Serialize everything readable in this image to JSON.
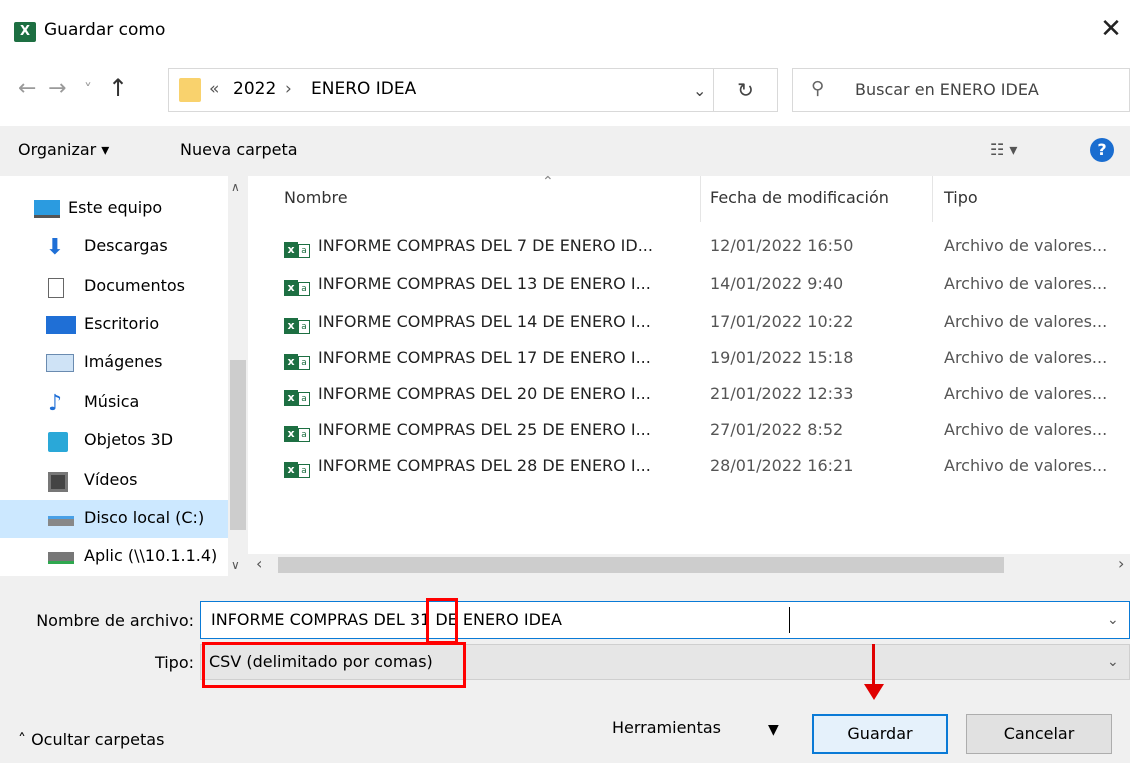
{
  "window": {
    "title": "Guardar como",
    "app_icon": "X",
    "close_glyph": "✕"
  },
  "nav": {
    "back_glyph": "←",
    "forward_glyph": "→",
    "recent_glyph": "˅",
    "up_glyph": "↑",
    "breadcrumb": {
      "overflow": "«",
      "items": [
        "2022",
        "ENERO IDEA"
      ],
      "separator": "›"
    },
    "refresh_glyph": "↻",
    "search_placeholder": "Buscar en ENERO IDEA"
  },
  "toolbar": {
    "organize_label": "Organizar ▾",
    "new_folder_label": "Nueva carpeta",
    "view_glyph": "☷ ▾",
    "help_glyph": "?"
  },
  "sidebar": {
    "items": [
      {
        "label": "Este equipo",
        "icon": "monitor-icon"
      },
      {
        "label": "Descargas",
        "icon": "download-icon"
      },
      {
        "label": "Documentos",
        "icon": "document-icon"
      },
      {
        "label": "Escritorio",
        "icon": "desktop-icon"
      },
      {
        "label": "Imágenes",
        "icon": "image-icon"
      },
      {
        "label": "Música",
        "icon": "music-icon"
      },
      {
        "label": "Objetos 3D",
        "icon": "cube-icon"
      },
      {
        "label": "Vídeos",
        "icon": "film-icon"
      },
      {
        "label": "Disco local (C:)",
        "icon": "drive-icon",
        "selected": true
      },
      {
        "label": "Aplic (\\\\10.1.1.4)",
        "icon": "network-drive-icon"
      }
    ]
  },
  "file_list": {
    "columns": [
      "Nombre",
      "Fecha de modificación",
      "Tipo"
    ],
    "rows": [
      {
        "name": "INFORME COMPRAS DEL 7 DE ENERO ID...",
        "date": "12/01/2022 16:50",
        "type": "Archivo de valores..."
      },
      {
        "name": "INFORME COMPRAS DEL 13 DE ENERO I...",
        "date": "14/01/2022 9:40",
        "type": "Archivo de valores..."
      },
      {
        "name": "INFORME COMPRAS DEL 14 DE ENERO I...",
        "date": "17/01/2022 10:22",
        "type": "Archivo de valores..."
      },
      {
        "name": "INFORME COMPRAS DEL 17 DE ENERO I...",
        "date": "19/01/2022 15:18",
        "type": "Archivo de valores..."
      },
      {
        "name": "INFORME COMPRAS DEL 20 DE ENERO I...",
        "date": "21/01/2022 12:33",
        "type": "Archivo de valores..."
      },
      {
        "name": "INFORME COMPRAS DEL 25 DE ENERO I...",
        "date": "27/01/2022 8:52",
        "type": "Archivo de valores..."
      },
      {
        "name": "INFORME COMPRAS DEL 28 DE ENERO I...",
        "date": "28/01/2022 16:21",
        "type": "Archivo de valores..."
      }
    ]
  },
  "save_form": {
    "filename_label": "Nombre de archivo:",
    "filename_value": "INFORME COMPRAS DEL 31 DE ENERO IDEA",
    "type_label": "Tipo:",
    "type_value": "CSV (delimitado por comas)"
  },
  "footer": {
    "hide_folders": "˄  Ocultar carpetas",
    "tools_label": "Herramientas",
    "tools_chevron": "▼",
    "save_button": "Guardar",
    "cancel_button": "Cancelar"
  },
  "colors": {
    "annotation_red": "#ff0000",
    "selection_blue": "#cce8ff",
    "excel_green": "#1d6f42",
    "focus_blue": "#0a7ad6"
  }
}
